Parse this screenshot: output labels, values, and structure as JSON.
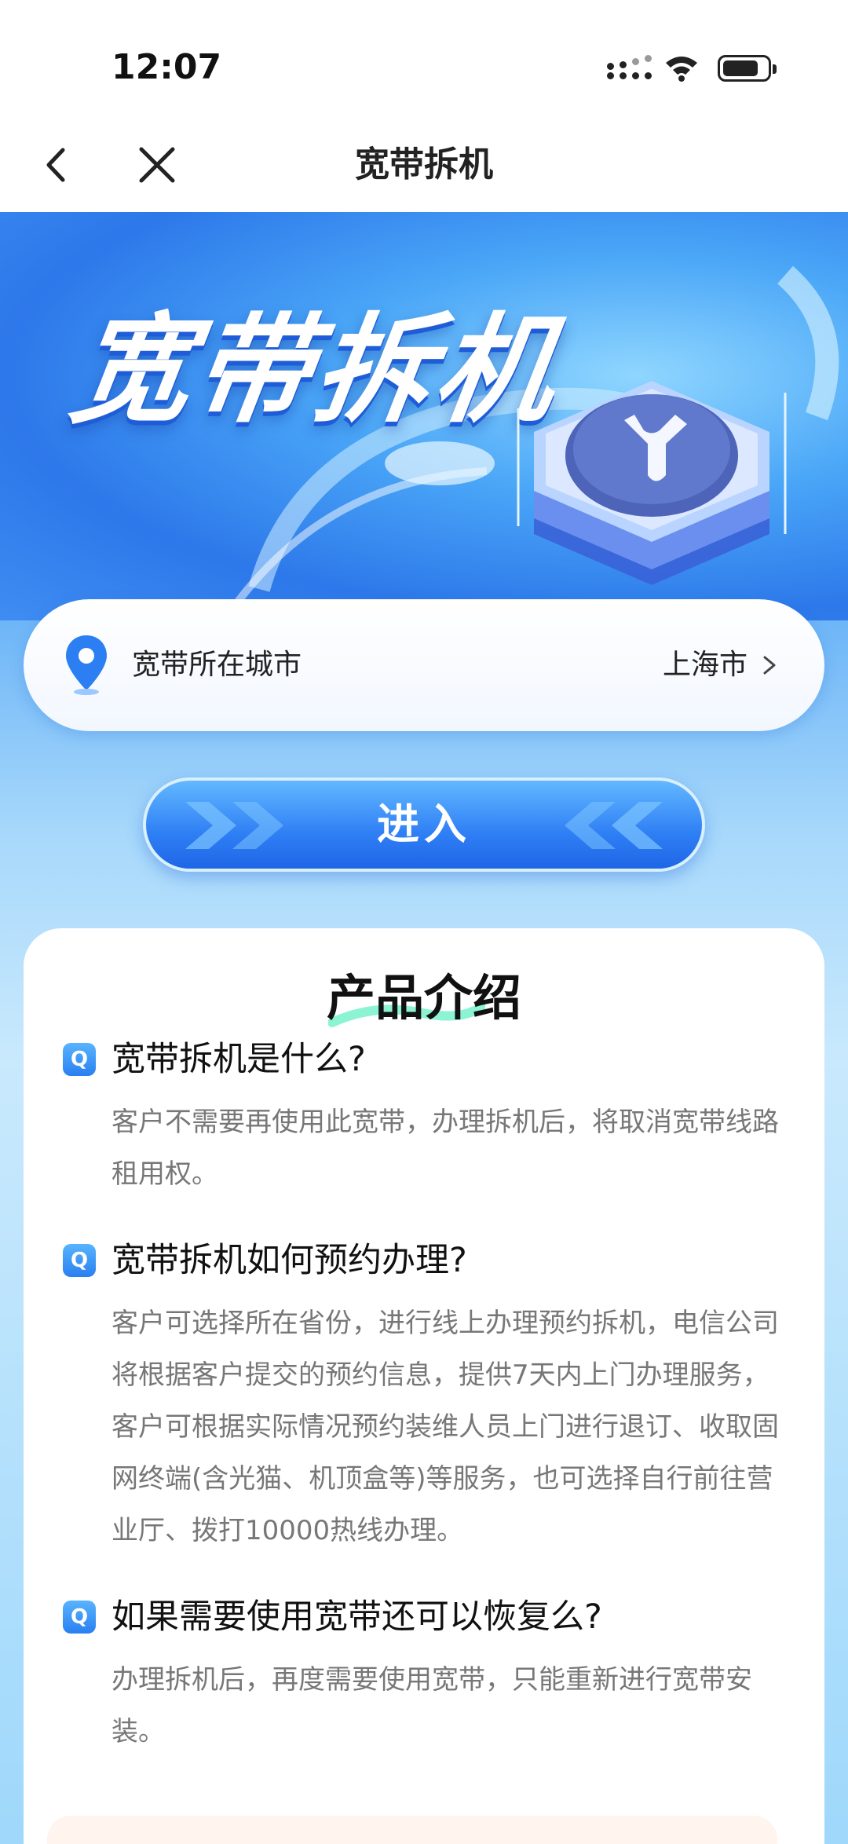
{
  "status_bar": {
    "time": "12:07"
  },
  "nav": {
    "title": "宽带拆机"
  },
  "hero": {
    "title": "宽带拆机"
  },
  "city": {
    "label": "宽带所在城市",
    "value": "上海市"
  },
  "enter_button": {
    "label": "进入"
  },
  "intro": {
    "title": "产品介绍",
    "qa": [
      {
        "question": "宽带拆机是什么?",
        "answer": "客户不需要再使用此宽带，办理拆机后，将取消宽带线路租用权。"
      },
      {
        "question": "宽带拆机如何预约办理?",
        "answer": "客户可选择所在省份，进行线上办理预约拆机，电信公司将根据客户提交的预约信息，提供7天内上门办理服务，客户可根据实际情况预约装维人员上门进行退订、收取固网终端(含光猫、机顶盒等)等服务，也可选择自行前往营业厅、拨打10000热线办理。"
      },
      {
        "question": "如果需要使用宽带还可以恢复么?",
        "answer": "办理拆机后，再度需要使用宽带，只能重新进行宽带安装。"
      }
    ]
  },
  "icons": {
    "q_icon": "Q"
  }
}
